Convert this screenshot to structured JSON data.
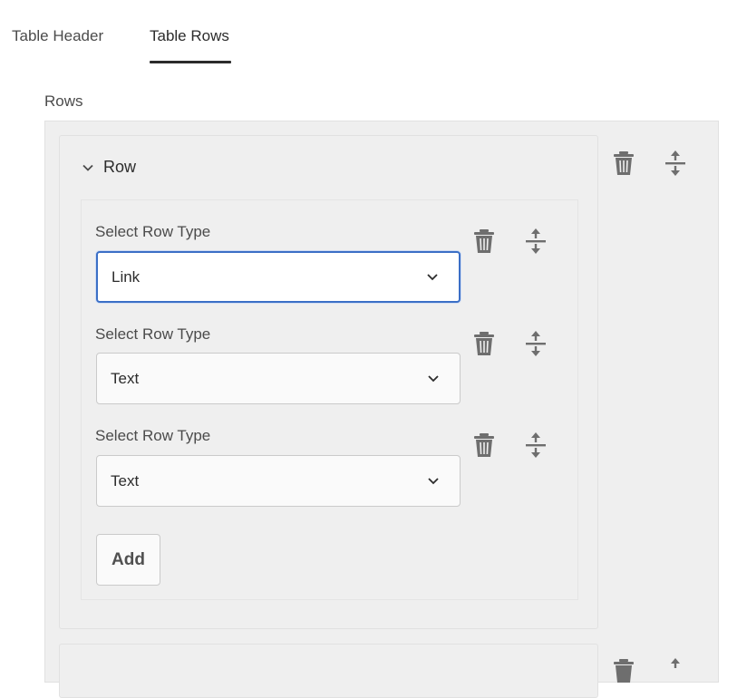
{
  "tabs": [
    {
      "label": "Table Header",
      "active": false
    },
    {
      "label": "Table Rows",
      "active": true
    }
  ],
  "section": {
    "label": "Rows"
  },
  "row_panel": {
    "title": "Row",
    "expanded": true,
    "fields": [
      {
        "label": "Select Row Type",
        "value": "Link",
        "focused": true
      },
      {
        "label": "Select Row Type",
        "value": "Text",
        "focused": false
      },
      {
        "label": "Select Row Type",
        "value": "Text",
        "focused": false
      }
    ],
    "add_label": "Add"
  },
  "icons": {
    "delete": "trash-icon",
    "reorder": "move-handle-icon",
    "expand": "chevron-down-icon"
  },
  "colors": {
    "focus_border": "#3b6fc6",
    "icon": "#6e6e6e",
    "panel_bg": "#efefef"
  }
}
